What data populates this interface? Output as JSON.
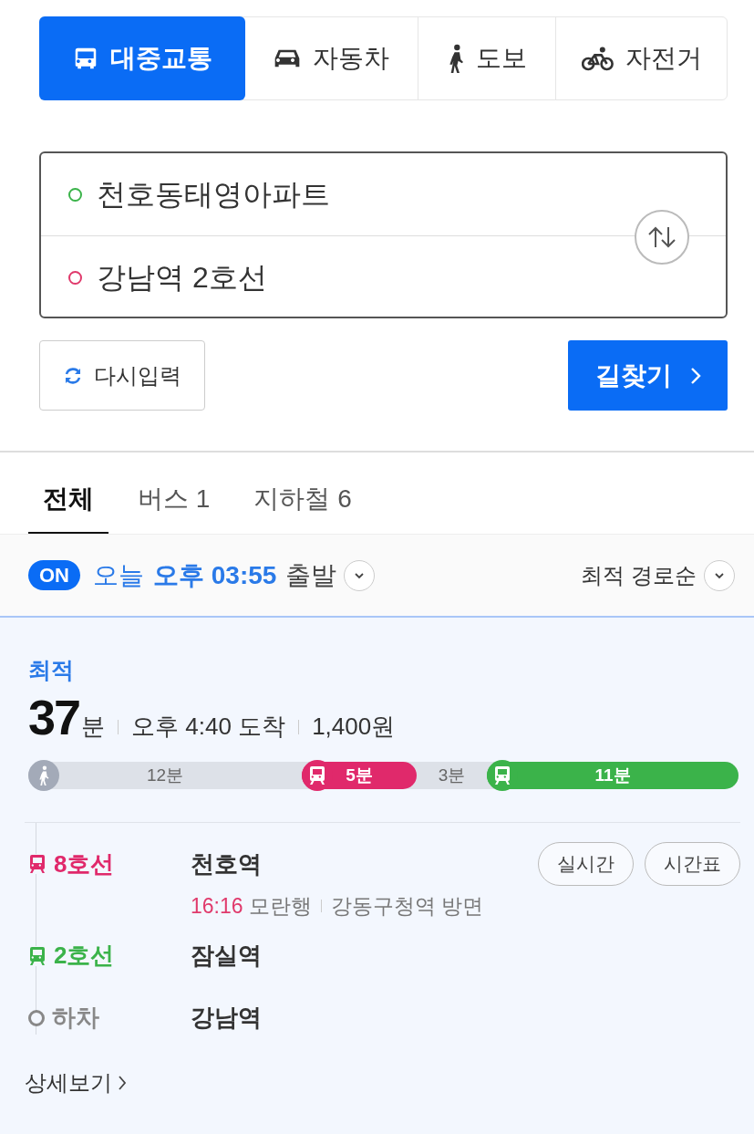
{
  "mode_tabs": [
    {
      "kind": "transit",
      "label": "대중교통",
      "selected": true
    },
    {
      "kind": "car",
      "label": "자동차",
      "selected": false
    },
    {
      "kind": "walk",
      "label": "도보",
      "selected": false
    },
    {
      "kind": "bike",
      "label": "자전거",
      "selected": false
    }
  ],
  "route_inputs": {
    "origin": "천호동태영아파트",
    "destination": "강남역 2호선"
  },
  "reset_button": "다시입력",
  "search_button": "길찾기",
  "result_tabs": [
    {
      "label": "전체",
      "selected": true
    },
    {
      "label": "버스 1",
      "selected": false
    },
    {
      "label": "지하철 6",
      "selected": false
    }
  ],
  "departure": {
    "toggle": "ON",
    "toggle_on": true,
    "day": "오늘",
    "time": "오후 03:55",
    "suffix": "출발"
  },
  "sort": "최적 경로순",
  "route": {
    "badge": "최적",
    "duration": "37",
    "duration_unit": "분",
    "arrival": "오후 4:40 도착",
    "fare": "1,400원",
    "segments": [
      {
        "kind": "walk",
        "time": "12분"
      },
      {
        "kind": "subway",
        "time": "5분",
        "color": "#e0296b"
      },
      {
        "kind": "transfer",
        "time": "3분"
      },
      {
        "kind": "subway",
        "time": "11분",
        "color": "#3bb34a"
      }
    ],
    "steps": [
      {
        "kind": "subway",
        "line": "8호선",
        "color": "#e0296b",
        "station": "천호역",
        "buttons": [
          "실시간",
          "시간표"
        ],
        "departure_time": "16:16",
        "destination": "모란행",
        "direction": "강동구청역 방면"
      },
      {
        "kind": "subway",
        "line": "2호선",
        "color": "#3bb34a",
        "station": "잠실역"
      },
      {
        "kind": "alight",
        "line": "하차",
        "station": "강남역"
      }
    ],
    "details_link": "상세보기"
  }
}
